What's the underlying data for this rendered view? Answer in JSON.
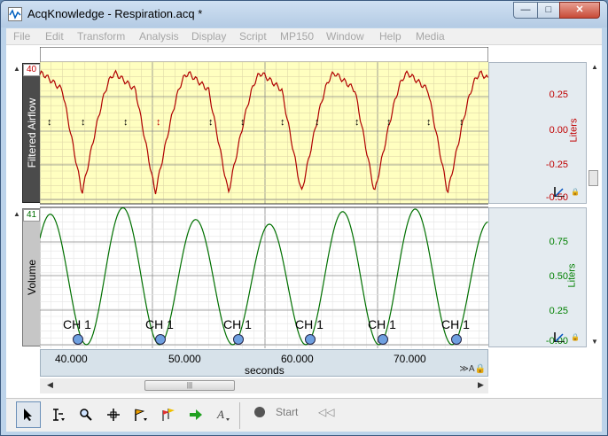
{
  "window": {
    "title": "AcqKnowledge - Respiration.acq *",
    "controls": {
      "minimize": "—",
      "maximize": "□",
      "close": "✕"
    }
  },
  "menubar": [
    "File",
    "Edit",
    "Transform",
    "Analysis",
    "Display",
    "Script",
    "MP150",
    "Window",
    "Help",
    "Media"
  ],
  "channels": [
    {
      "name": "Filtered Airflow",
      "number": "40",
      "unit": "Liters",
      "color": "#c00000",
      "background": "#ffffc0",
      "scale_ticks": [
        "0.25",
        "0.00",
        "-0.25",
        "-0.50"
      ],
      "event_markers": 12
    },
    {
      "name": "Volume",
      "number": "41",
      "unit": "Liters",
      "color": "#008000",
      "background": "#ffffff",
      "scale_ticks": [
        "0.75",
        "0.50",
        "0.25",
        "-0.00"
      ],
      "event_label": "CH 1",
      "event_markers": 6
    }
  ],
  "xaxis": {
    "ticks": [
      "40.000",
      "50.000",
      "60.000",
      "70.000"
    ],
    "unit": "seconds"
  },
  "toolbar": {
    "tools": [
      "arrow-tool",
      "ibeam-zoom-tool",
      "magnifier-tool",
      "crosshair-tool",
      "event-flag-tool",
      "multi-flag-tool",
      "go-arrow-tool",
      "text-tool"
    ],
    "start_label": "Start"
  }
}
